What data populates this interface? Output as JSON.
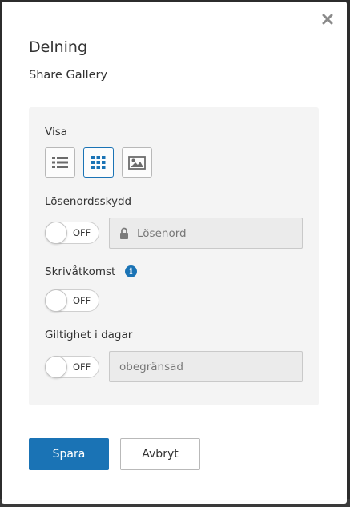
{
  "dialog": {
    "title": "Delning",
    "subtitle": "Share Gallery",
    "close_icon": "close-icon"
  },
  "view": {
    "label": "Visa",
    "options": [
      {
        "icon": "list-view-icon",
        "selected": false
      },
      {
        "icon": "grid-view-icon",
        "selected": true
      },
      {
        "icon": "image-view-icon",
        "selected": false
      }
    ]
  },
  "password": {
    "label": "Lösenordsskydd",
    "toggle_state": "OFF",
    "placeholder": "Lösenord",
    "icon": "lock-icon"
  },
  "write_access": {
    "label": "Skrivåtkomst",
    "info_glyph": "i",
    "toggle_state": "OFF"
  },
  "validity": {
    "label": "Giltighet i dagar",
    "toggle_state": "OFF",
    "placeholder": "obegränsad"
  },
  "actions": {
    "save_label": "Spara",
    "cancel_label": "Avbryt"
  },
  "colors": {
    "accent": "#1a73b5",
    "panel_bg": "#f4f4f4",
    "field_bg": "#ebebeb",
    "icon_gray": "#6b6b6b"
  }
}
